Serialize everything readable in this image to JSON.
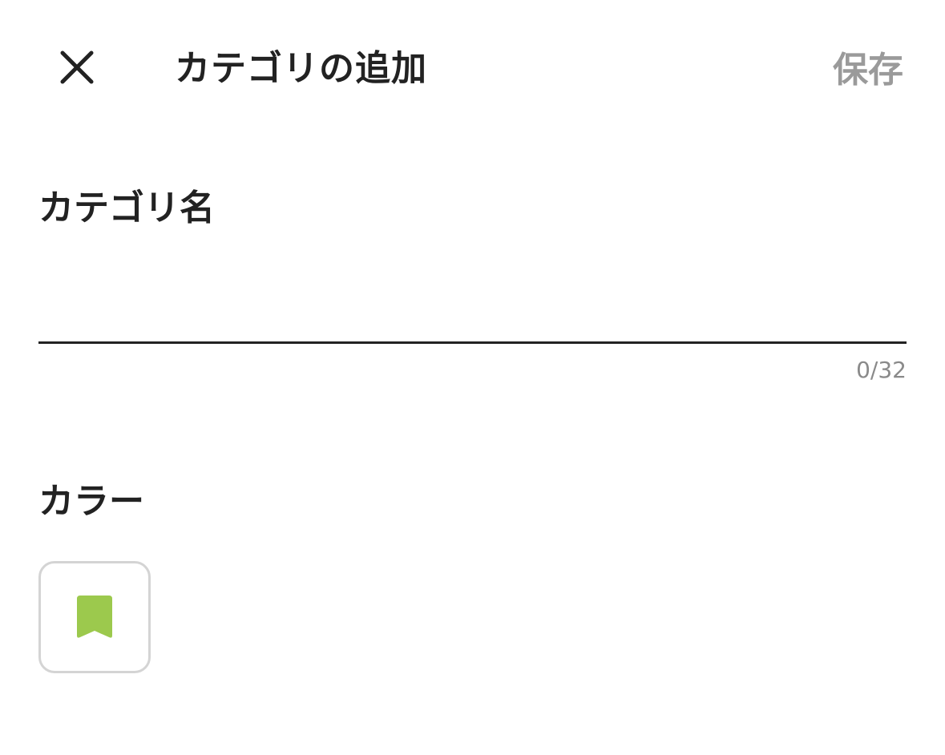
{
  "header": {
    "close_icon": "close-icon",
    "title": "カテゴリの追加",
    "save_label": "保存"
  },
  "name_field": {
    "label": "カテゴリ名",
    "value": "",
    "counter": "0/32"
  },
  "color_field": {
    "label": "カラー",
    "icon": "bookmark-icon",
    "selected_color": "#9CC94D"
  },
  "colors": {
    "text": "#222222",
    "disabled": "#9A9A9A",
    "swatch_border": "#D4D4D4"
  }
}
